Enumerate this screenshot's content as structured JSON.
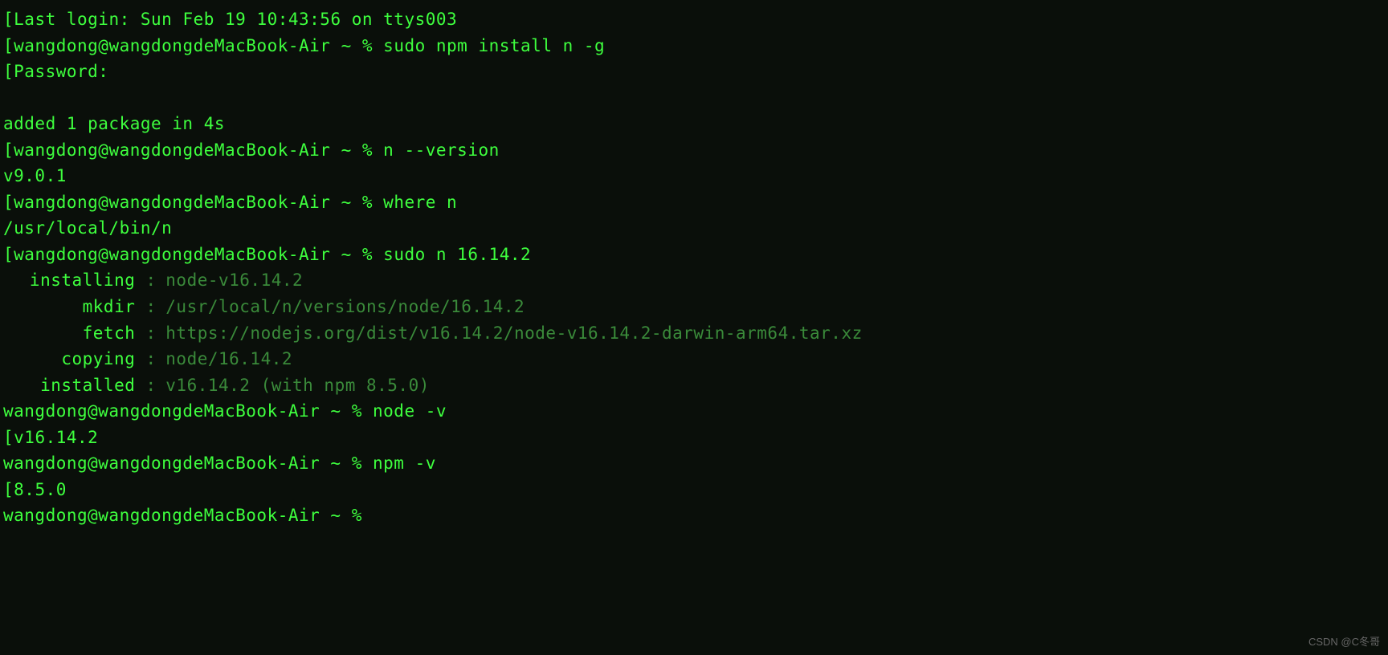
{
  "terminal": {
    "lastLogin": "Last login: Sun Feb 19 10:43:56 on ttys003",
    "prompt": "wangdong@wangdongdeMacBook-Air ~ % ",
    "lines": {
      "cmd1": "sudo npm install n -g",
      "password": "Password:",
      "blank": "",
      "added": "added 1 package in 4s",
      "cmd2": "n --version",
      "nVersion": "v9.0.1",
      "cmd3": "where n",
      "wherePath": "/usr/local/bin/n",
      "cmd4": "sudo n 16.14.2",
      "installing_label": "installing",
      "installing_value": "node-v16.14.2",
      "mkdir_label": "mkdir",
      "mkdir_value": "/usr/local/n/versions/node/16.14.2",
      "fetch_label": "fetch",
      "fetch_value": "https://nodejs.org/dist/v16.14.2/node-v16.14.2-darwin-arm64.tar.xz",
      "copying_label": "copying",
      "copying_value": "node/16.14.2",
      "installed_label": "installed",
      "installed_value": "v16.14.2 (with npm 8.5.0)",
      "cmd5": "node -v",
      "nodeVersion": "v16.14.2",
      "cmd6": "npm -v",
      "npmVersion": "8.5.0",
      "sep": " : "
    }
  },
  "watermark": "CSDN @C冬哥"
}
